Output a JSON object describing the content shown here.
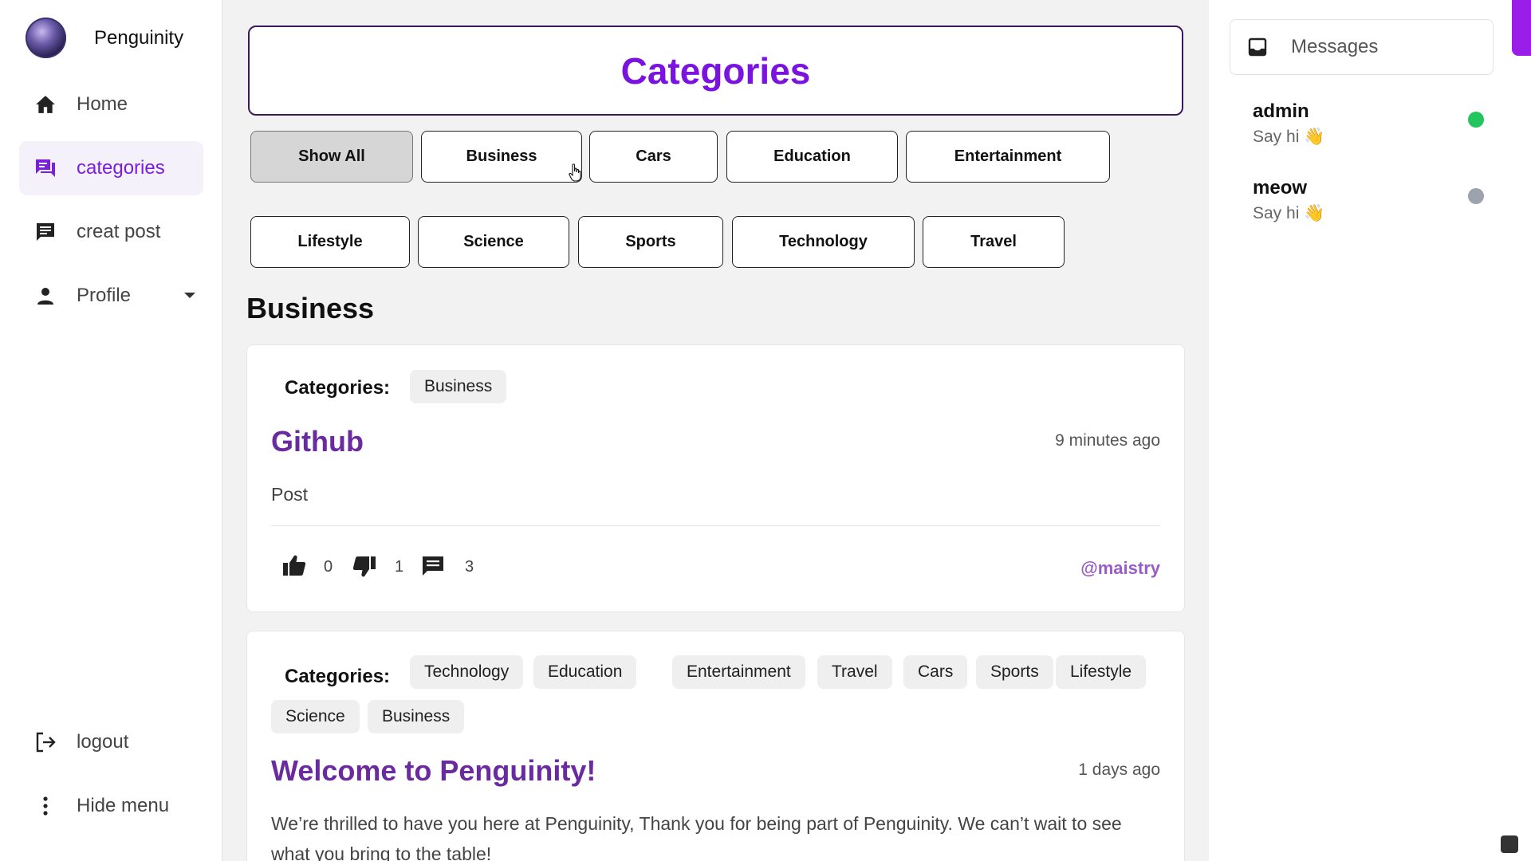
{
  "app": {
    "name": "Penguinity"
  },
  "sidebar": {
    "items": [
      {
        "label": "Home",
        "icon": "home-icon"
      },
      {
        "label": "categories",
        "icon": "forum-icon",
        "active": true
      },
      {
        "label": "creat post",
        "icon": "chat-post-icon"
      },
      {
        "label": "Profile",
        "icon": "person-icon"
      }
    ],
    "logout_label": "logout",
    "hide_menu_label": "Hide menu"
  },
  "page": {
    "title": "Categories",
    "section_title": "Business",
    "categories_label": "Categories:"
  },
  "filters": {
    "row1": [
      "Show All",
      "Business",
      "Cars",
      "Education",
      "Entertainment"
    ],
    "row2": [
      "Lifestyle",
      "Science",
      "Sports",
      "Technology",
      "Travel"
    ],
    "selected": "Show All"
  },
  "posts": [
    {
      "categories": [
        "Business"
      ],
      "title": "Github",
      "time": "9 minutes ago",
      "body": "Post",
      "likes": "0",
      "dislikes": "1",
      "comments": "3",
      "author": "@maistry"
    },
    {
      "categories": [
        "Technology",
        "Education",
        "Entertainment",
        "Travel",
        "Cars",
        "Sports",
        "Lifestyle",
        "Science",
        "Business"
      ],
      "title": "Welcome to Penguinity!",
      "time": "1 days ago",
      "body": "We’re thrilled to have you here at Penguinity, Thank you for being part of Penguinity. We can’t wait to see what you bring to the table!"
    }
  ],
  "messages": {
    "title": "Messages",
    "users": [
      {
        "name": "admin",
        "subtitle": "Say hi",
        "emoji": "👋",
        "status": "online",
        "status_color": "#22c55e"
      },
      {
        "name": "meow",
        "subtitle": "Say hi",
        "emoji": "👋",
        "status": "offline",
        "status_color": "#9ca3af"
      }
    ]
  },
  "colors": {
    "accent": "#7a12e0",
    "post_title": "#6a2aa0",
    "author": "#9a5cc8",
    "scrollbar": "#9b1ee8"
  }
}
